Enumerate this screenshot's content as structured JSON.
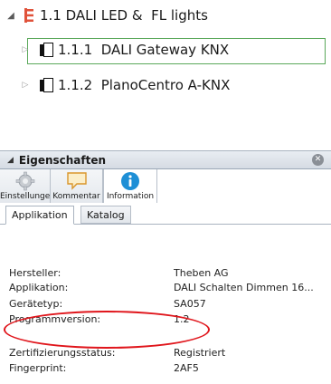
{
  "tree": {
    "group": {
      "label": "1.1 DALI LED &  FL lights",
      "expanded": true
    },
    "devices": [
      {
        "label": "1.1.1  DALI Gateway KNX",
        "selected": true
      },
      {
        "label": "1.1.2  PlanoCentro A-KNX",
        "selected": false
      }
    ],
    "colors": {
      "group_icon": "#e0523a",
      "selection_border": "#5aa85a"
    }
  },
  "panel": {
    "title": "Eigenschaften",
    "tool_tabs": [
      {
        "label": "Einstellungen",
        "icon": "gear-icon"
      },
      {
        "label": "Kommentar",
        "icon": "comment-icon"
      },
      {
        "label": "Information",
        "icon": "info-icon",
        "active": true
      }
    ],
    "sub_tabs": [
      "Applikation",
      "Katalog"
    ],
    "properties": [
      {
        "name": "Hersteller:",
        "value": "Theben AG"
      },
      {
        "name": "Applikation:",
        "value": "DALI Schalten Dimmen 16..."
      },
      {
        "name": "Gerätetyp:",
        "value": "SA057"
      },
      {
        "name": "Programmversion:",
        "value": "1.2"
      },
      {
        "name": "Zertifizierungsstatus:",
        "value": "Registriert"
      },
      {
        "name": "Fingerprint:",
        "value": "2AF5"
      }
    ],
    "highlight_color": "#e0161c",
    "info_icon_color": "#1e8fd6"
  }
}
